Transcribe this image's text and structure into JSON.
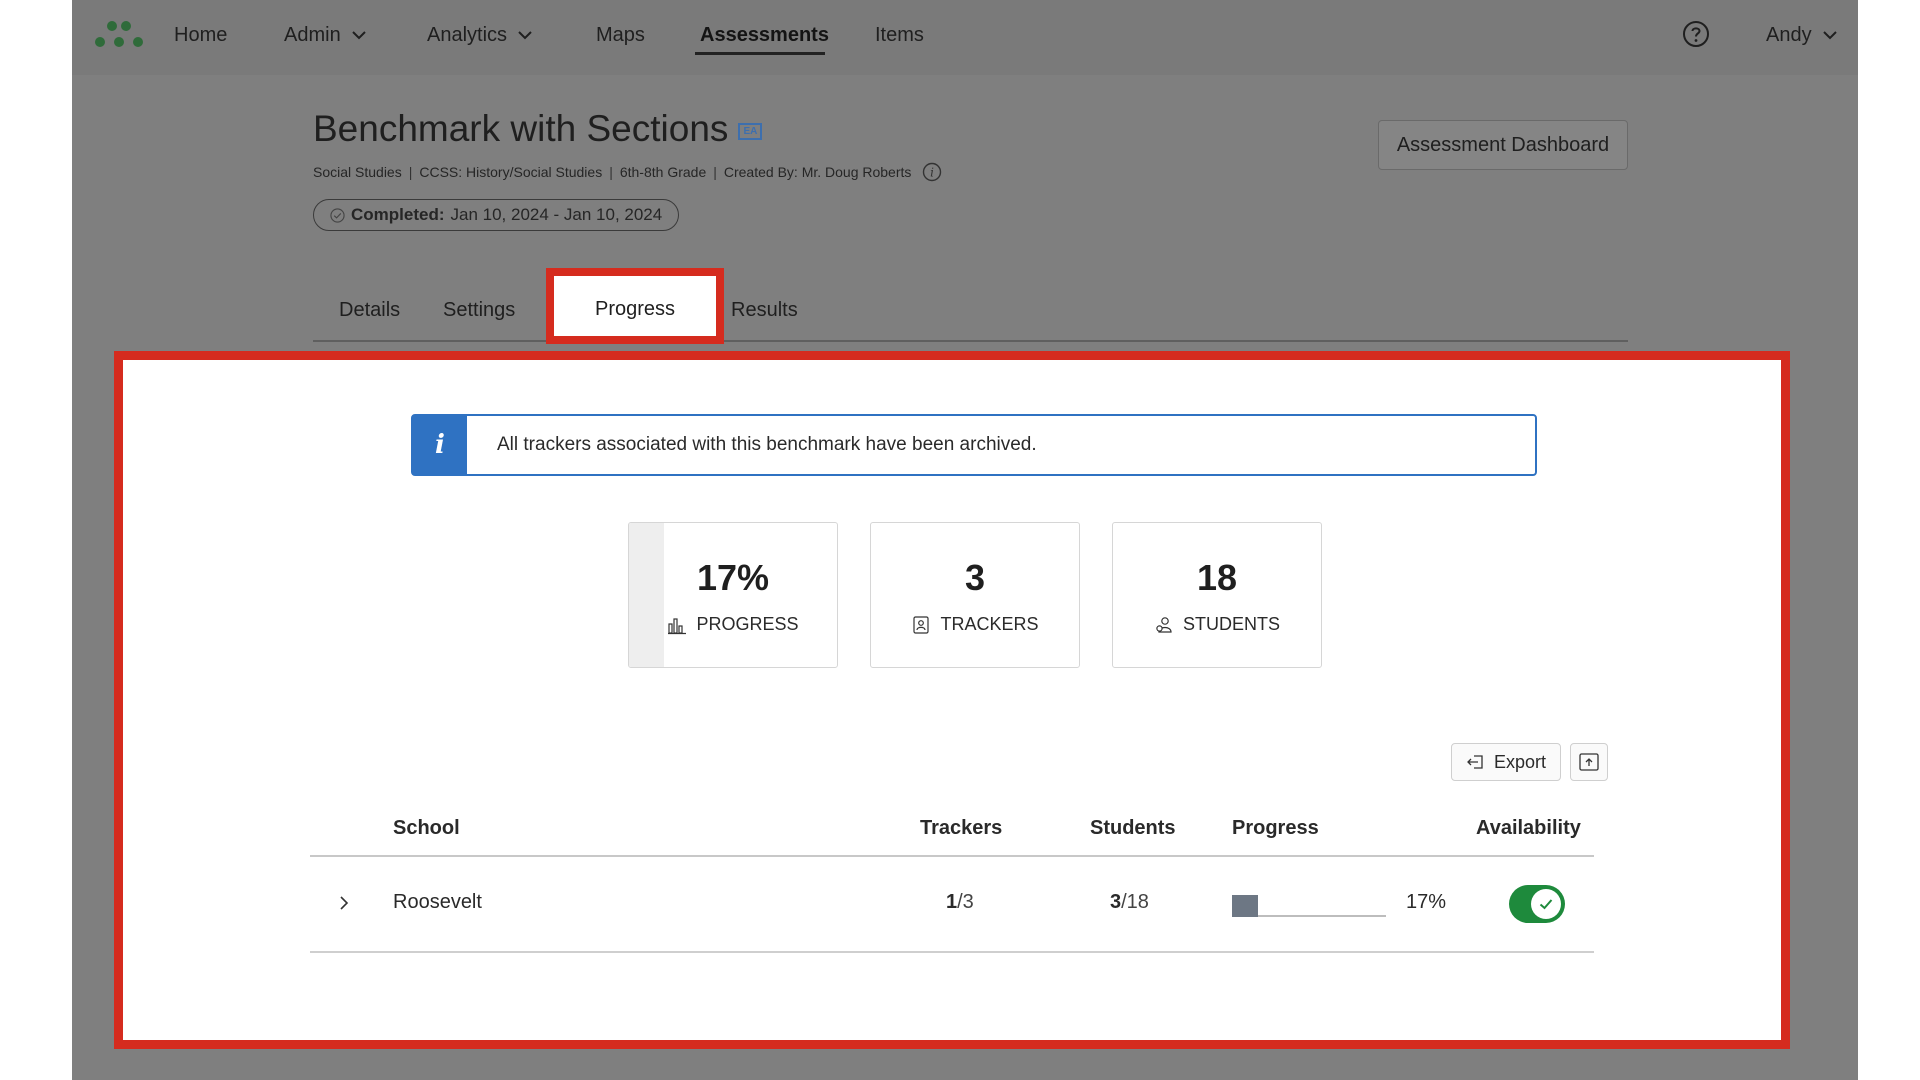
{
  "nav": {
    "items": [
      {
        "label": "Home",
        "has_dropdown": false
      },
      {
        "label": "Admin",
        "has_dropdown": true
      },
      {
        "label": "Analytics",
        "has_dropdown": true
      },
      {
        "label": "Maps",
        "has_dropdown": false
      },
      {
        "label": "Assessments",
        "has_dropdown": false,
        "active": true
      },
      {
        "label": "Items",
        "has_dropdown": false
      }
    ],
    "user": "Andy",
    "logo_icon": "dots-logo-icon",
    "help_icon": "question-circle-icon"
  },
  "header": {
    "title": "Benchmark with Sections",
    "badge": "EA",
    "meta": [
      "Social Studies",
      "CCSS: History/Social Studies",
      "6th-8th Grade",
      "Created By: Mr. Doug Roberts"
    ],
    "status_label": "Completed:",
    "status_dates": "Jan 10, 2024 - Jan 10, 2024",
    "dashboard_button": "Assessment Dashboard"
  },
  "tabs": {
    "items": [
      "Details",
      "Settings",
      "Progress",
      "Results"
    ],
    "active": "Progress"
  },
  "alert": {
    "icon": "i",
    "text": "All trackers associated with this benchmark have been archived."
  },
  "stats": [
    {
      "value": "17%",
      "label": "PROGRESS",
      "icon": "bar-chart-icon",
      "fill_fraction": 0.17
    },
    {
      "value": "3",
      "label": "TRACKERS",
      "icon": "tracker-icon"
    },
    {
      "value": "18",
      "label": "STUDENTS",
      "icon": "students-icon"
    }
  ],
  "toolbar": {
    "export_label": "Export"
  },
  "table": {
    "columns": [
      "School",
      "Trackers",
      "Students",
      "Progress",
      "Availability"
    ],
    "rows": [
      {
        "school": "Roosevelt",
        "trackers_done": "1",
        "trackers_total": "/3",
        "students_done": "3",
        "students_total": "/18",
        "progress_text": "17%",
        "progress_fraction": 0.17,
        "available": true
      }
    ]
  },
  "colors": {
    "accent_blue": "#2f72c2",
    "highlight_red": "#d52b1e",
    "toggle_green": "#1e8a3c"
  }
}
